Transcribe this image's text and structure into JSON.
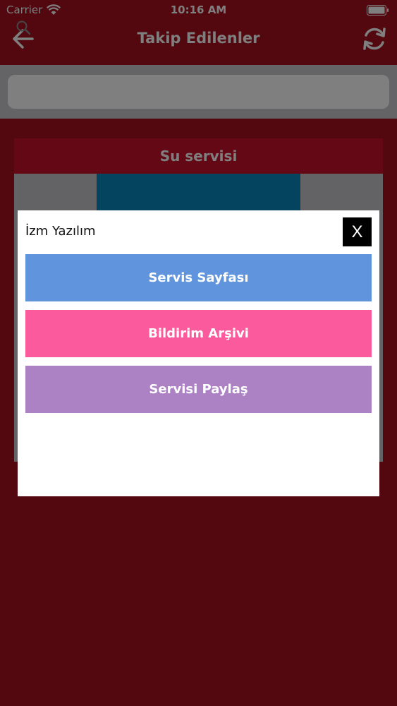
{
  "status_bar": {
    "carrier": "Carrier",
    "time": "10:16 AM",
    "wifi_icon": "wifi-icon",
    "battery_icon": "battery-icon"
  },
  "nav": {
    "title": "Takip Edilenler",
    "back_icon": "back-arrow-icon",
    "refresh_icon": "refresh-icon"
  },
  "search": {
    "placeholder": "",
    "value": "",
    "icon": "search-icon"
  },
  "background_list": {
    "card_title": "Su servisi",
    "image_color": "#0b89bd"
  },
  "modal": {
    "title": "İzm Yazılım",
    "close_label": "X",
    "actions": [
      {
        "label": "Servis Sayfası",
        "color": "#6094dc"
      },
      {
        "label": "Bildirim Arşivi",
        "color": "#fb5a9c"
      },
      {
        "label": "Servisi Paylaş",
        "color": "#ac82c5"
      }
    ]
  },
  "colors": {
    "brand_red": "#a4101c",
    "overlay": "rgba(0,0,0,0.5)"
  }
}
